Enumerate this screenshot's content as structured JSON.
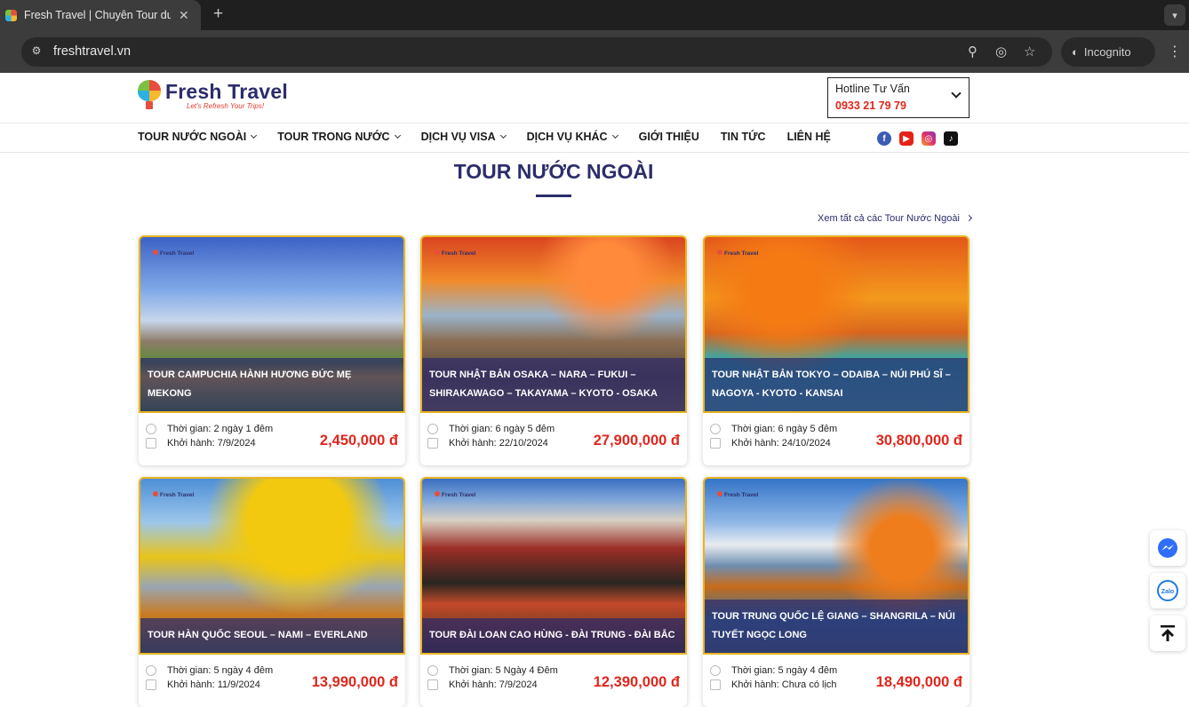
{
  "browser": {
    "tab_title": "Fresh Travel | Chuyên Tour du",
    "url": "freshtravel.vn",
    "incognito_label": "Incognito"
  },
  "header": {
    "brand_name": "Fresh Travel",
    "tagline": "Let's Refresh Your Trips!",
    "hotline_label": "Hotline Tư Vấn",
    "hotline_number": "0933 21 79 79"
  },
  "nav": {
    "items": [
      {
        "label": "TOUR NƯỚC NGOÀI",
        "dropdown": true
      },
      {
        "label": "TOUR TRONG NƯỚC",
        "dropdown": true
      },
      {
        "label": "DỊCH VỤ VISA",
        "dropdown": true
      },
      {
        "label": "DỊCH VỤ KHÁC",
        "dropdown": true
      },
      {
        "label": "GIỚI THIỆU",
        "dropdown": false
      },
      {
        "label": "TIN TỨC",
        "dropdown": false
      },
      {
        "label": "LIÊN HỆ",
        "dropdown": false
      }
    ]
  },
  "social": [
    "facebook-icon",
    "youtube-icon",
    "instagram-icon",
    "tiktok-icon"
  ],
  "section": {
    "title": "TOUR NƯỚC NGOÀI",
    "view_all": "Xem tất cả các Tour Nước Ngoài"
  },
  "tours": [
    {
      "title": "TOUR CAMPUCHIA HÀNH HƯƠNG ĐỨC MẸ MEKONG",
      "duration": "Thời gian: 2 ngày 1 đêm",
      "departure": "Khởi hành: 7/9/2024",
      "price": "2,450,000 đ"
    },
    {
      "title": "TOUR NHẬT BẢN OSAKA – NARA – FUKUI – SHIRAKAWAGO – TAKAYAMA – KYOTO - OSAKA",
      "duration": "Thời gian: 6 ngày 5 đêm",
      "departure": "Khởi hành: 22/10/2024",
      "price": "27,900,000 đ"
    },
    {
      "title": "TOUR NHẬT BẢN TOKYO – ODAIBA – NÚI PHÚ SĨ – NAGOYA - KYOTO - KANSAI",
      "duration": "Thời gian: 6 ngày 5 đêm",
      "departure": "Khởi hành: 24/10/2024",
      "price": "30,800,000 đ"
    },
    {
      "title": "TOUR HÀN QUỐC SEOUL – NAMI – EVERLAND",
      "duration": "Thời gian: 5 ngày 4 đêm",
      "departure": "Khởi hành: 11/9/2024",
      "price": "13,990,000 đ"
    },
    {
      "title": "TOUR ĐÀI LOAN CAO HÙNG - ĐÀI TRUNG - ĐÀI BẮC",
      "duration": "Thời gian: 5 Ngày 4 Đêm",
      "departure": "Khởi hành: 7/9/2024",
      "price": "12,390,000 đ"
    },
    {
      "title": "TOUR TRUNG QUỐC LỆ GIANG – SHANGRILA – NÚI TUYẾT NGỌC LONG",
      "duration": "Thời gian: 5 ngày 4 đêm",
      "departure": "Khởi hành: Chưa có lịch",
      "price": "18,490,000 đ"
    }
  ],
  "card_stamp": "Fresh Travel",
  "colors": {
    "brand": "#2c2d6b",
    "price": "#e0261c",
    "card_border": "#e9b422"
  }
}
